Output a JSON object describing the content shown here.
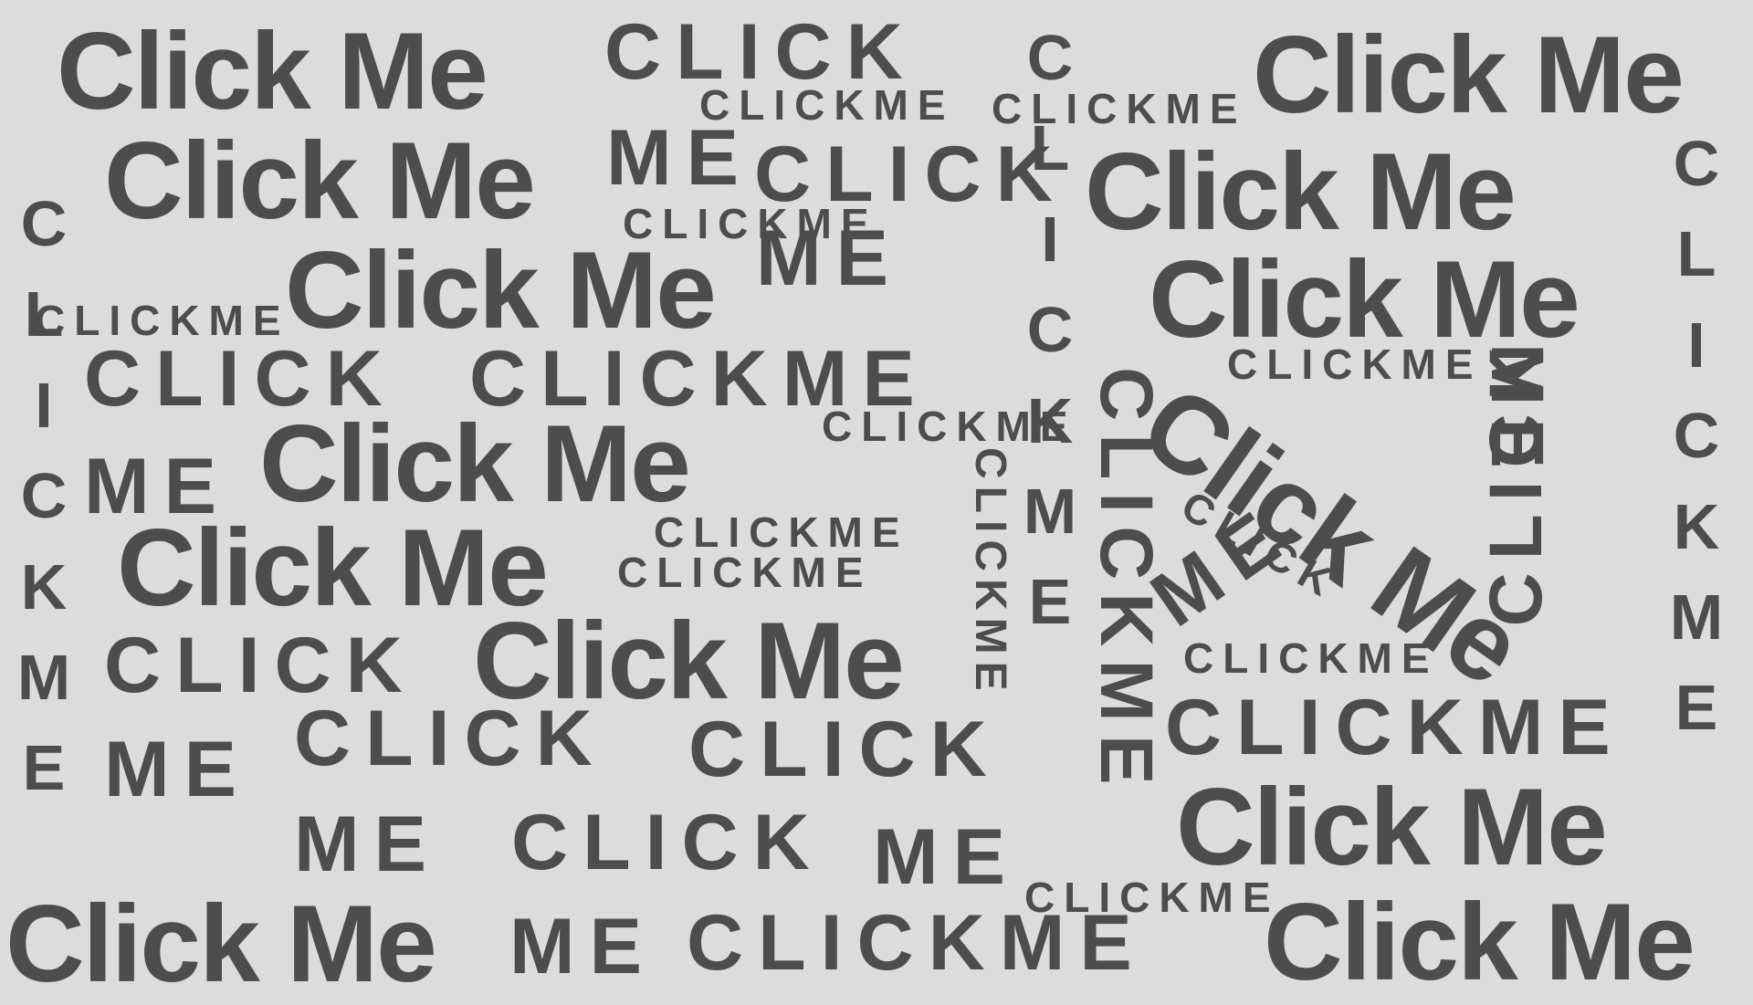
{
  "big_label": "Click Me",
  "spaced": {
    "clickme": "CLICKME",
    "click": "CLICK",
    "me": "ME"
  },
  "vertical_letters": [
    "C",
    "L",
    "I",
    "C",
    "K",
    "M",
    "E"
  ],
  "colors": {
    "background": "#dcdcdc",
    "text": "#4d4d4d"
  }
}
